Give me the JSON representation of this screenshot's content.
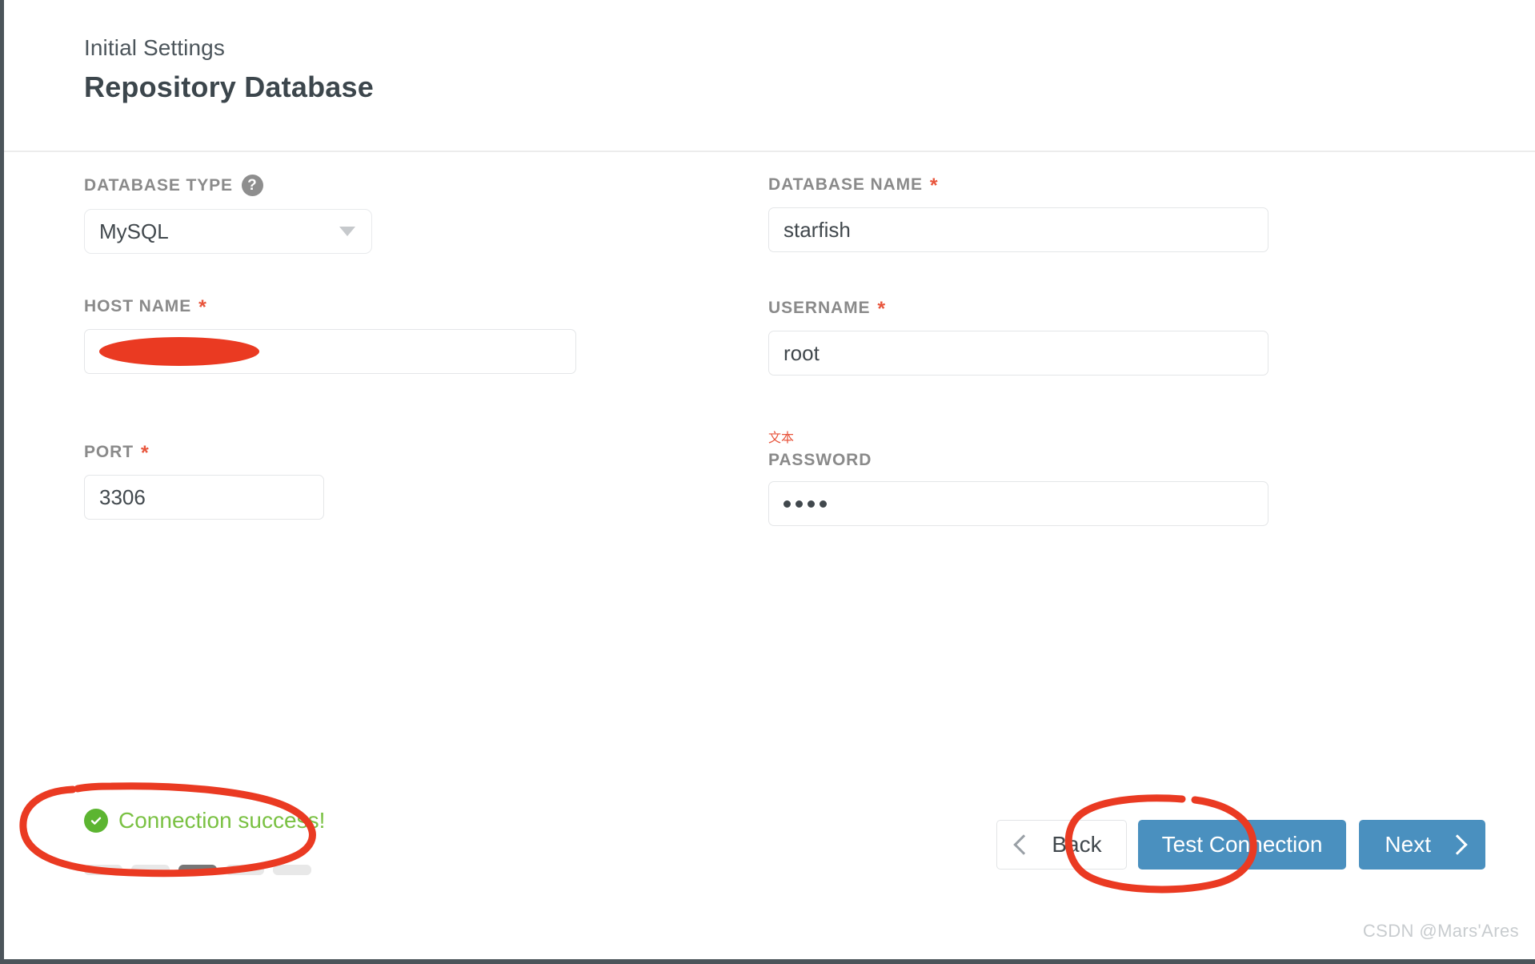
{
  "header": {
    "eyebrow": "Initial Settings",
    "title": "Repository Database"
  },
  "form": {
    "left": {
      "database_type": {
        "label": "DATABASE TYPE",
        "help_icon": "question-mark-icon",
        "value": "MySQL",
        "required": false
      },
      "host_name": {
        "label": "HOST NAME",
        "required_marker": "*",
        "value": "",
        "redacted": true
      },
      "port": {
        "label": "PORT",
        "required_marker": "*",
        "value": "3306"
      }
    },
    "right": {
      "database_name": {
        "label": "DATABASE NAME",
        "required_marker": "*",
        "value": "starfish"
      },
      "username": {
        "label": "USERNAME",
        "required_marker": "*",
        "value": "root"
      },
      "password": {
        "note": "文本",
        "label": "PASSWORD",
        "value": "••••",
        "dot_count": 4
      }
    }
  },
  "status": {
    "icon": "check-circle-icon",
    "text": "Connection success!",
    "color": "#7ac143"
  },
  "steps": {
    "total": 5,
    "active_index": 3
  },
  "footer": {
    "back_label": "Back",
    "back_icon": "chevron-left-icon",
    "test_label": "Test Connection",
    "next_label": "Next",
    "next_icon": "chevron-right-icon",
    "primary_color": "#4a90bf"
  },
  "annotations": {
    "color": "#ea3a22",
    "status_circle": "hand-drawn-ellipse-around-connection-success",
    "test_circle": "hand-drawn-ellipse-around-test-connection"
  },
  "watermark": "CSDN @Mars'Ares"
}
